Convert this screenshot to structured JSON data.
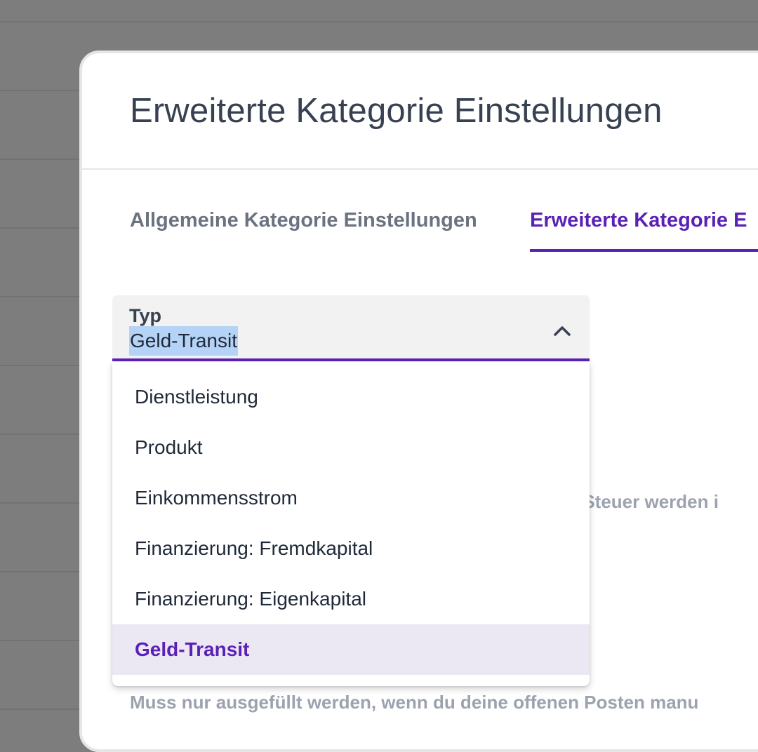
{
  "modal": {
    "title": "Erweiterte Kategorie Einstellungen",
    "tabs": [
      {
        "label": "Allgemeine Kategorie Einstellungen",
        "active": false
      },
      {
        "label": "Erweiterte Kategorie E",
        "active": true
      }
    ],
    "background_text_1": "r Steuer werden i",
    "background_text_2": "Muss nur ausgefüllt werden, wenn du deine offenen Posten manu"
  },
  "select": {
    "label": "Typ",
    "value": "Geld-Transit",
    "icon": "chevron-up-icon"
  },
  "dropdown": {
    "options": [
      "Dienstleistung",
      "Produkt",
      "Einkommensstrom",
      "Finanzierung: Fremdkapital",
      "Finanzierung: Eigenkapital",
      "Geld-Transit"
    ],
    "selected": "Geld-Transit"
  },
  "colors": {
    "accent": "#5b21b6",
    "overlay": "#7d7d7d",
    "selected_bg": "#ebe7f3",
    "text_highlight": "#b4d3f7"
  }
}
